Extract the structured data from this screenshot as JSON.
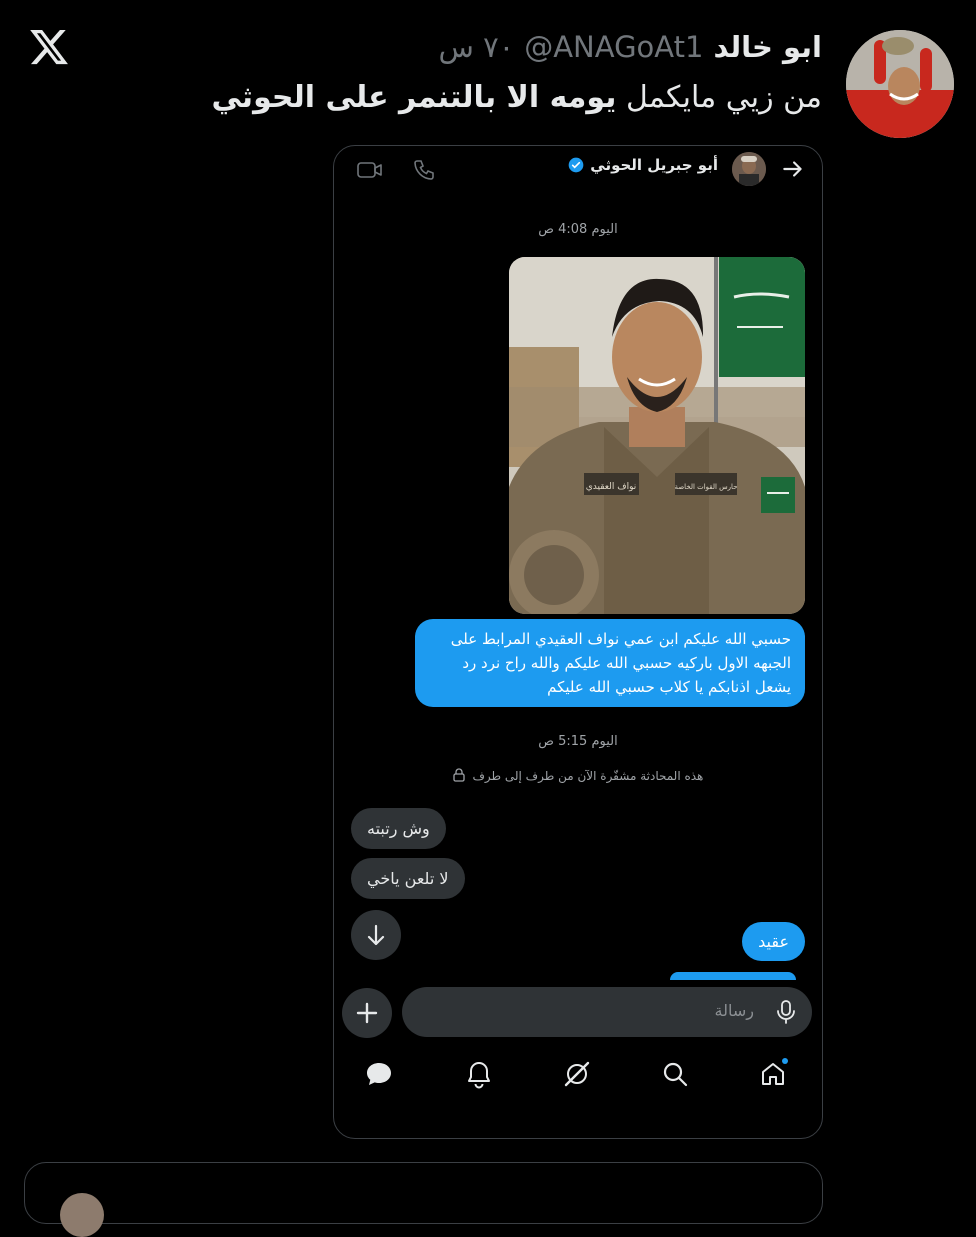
{
  "tweet": {
    "author_name": "ابو خالد",
    "author_handle": "@ANAGoAt1",
    "time_ago": "٧٠ س",
    "text_part1": "من زيي مايكمل ",
    "text_part2": "يومه الا بالتنمر على الحوثي"
  },
  "dm": {
    "contact_name": "أبو جبريل الحوثي",
    "timestamp_1": "اليوم 4:08 ص",
    "sent_message_1": "حسبي الله عليكم ابن عمي نواف العقيدي المرابط على الجبهه الاول باركيه حسبي الله عليكم والله راح نرد رد يشعل اذنابكم يا كلاب حسبي الله عليكم",
    "timestamp_2": "اليوم 5:15 ص",
    "encryption_note": "هذه المحادثة مشفّرة الآن من طرف إلى طرف",
    "received_1": "وش رتبته",
    "received_2": "لا تلعن ياخي",
    "sent_message_2": "عقيد",
    "composer_placeholder": "رسالة",
    "photo_labels": {
      "name_tag": "نواف العقيدي",
      "unit_tag": "حارس القوات الخاصة"
    }
  },
  "icons": {
    "app_logo": "x-logo",
    "back": "arrow-right-icon",
    "verified": "verified-badge-icon",
    "phone": "phone-icon",
    "video": "video-camera-icon",
    "lock": "lock-icon",
    "scroll": "arrow-down-icon",
    "plus": "plus-icon",
    "mic": "microphone-icon",
    "tabs": [
      "home-icon",
      "search-icon",
      "grok-icon",
      "bell-icon",
      "messages-icon"
    ]
  },
  "colors": {
    "accent": "#1d9bf0",
    "background": "#000000",
    "bubble_received": "#2f3336",
    "muted_text": "#71767b"
  }
}
